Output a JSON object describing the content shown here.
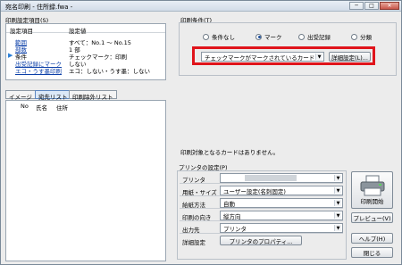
{
  "window": {
    "title": "宛名印刷 - 住所録.fwa -",
    "minimize": "─",
    "maximize": "□",
    "close": "✕"
  },
  "settings": {
    "group_label": "印刷設定項目(S)",
    "header_item": "設定項目",
    "header_value": "設定値",
    "rows": [
      {
        "key": "範囲",
        "value": "すべて：No.1 ～ No.15",
        "link": true
      },
      {
        "key": "部数",
        "value": "1 部",
        "link": true
      },
      {
        "key": "条件",
        "value": "チェックマーク：印刷",
        "link": false,
        "selected": true
      },
      {
        "key": "出受記録にマーク",
        "value": "しない",
        "link": true
      },
      {
        "key": "エコ・うす墨印刷",
        "value": "エコ：しない・うす墨：しない",
        "link": true
      }
    ]
  },
  "tabs": [
    {
      "label": "イメージ",
      "active": false
    },
    {
      "label": "宛先リスト",
      "active": true
    },
    {
      "label": "印刷除外リスト",
      "active": false
    }
  ],
  "list": {
    "col_no": "No",
    "col_name": "氏名",
    "col_address": "住所"
  },
  "conditions": {
    "group_label": "印刷条件(T)",
    "radios": [
      {
        "label": "条件なし",
        "checked": false
      },
      {
        "label": "マーク",
        "checked": true
      },
      {
        "label": "出受記録",
        "checked": false
      },
      {
        "label": "分類",
        "checked": false
      }
    ],
    "select_value": "チェックマークがマークされているカード",
    "detail_button": "詳細設定(L)...",
    "highlight_color": "#e0141b"
  },
  "message": "印刷対象となるカードはありません。",
  "printer": {
    "group_label": "プリンタの設定(P)",
    "rows": [
      {
        "key": "プリンタ",
        "value": ""
      },
      {
        "key": "用紙・サイズ",
        "value": "ユーザー設定(名刺固定)"
      },
      {
        "key": "給紙方法",
        "value": "自動"
      },
      {
        "key": "印刷の向き",
        "value": "縦方向"
      },
      {
        "key": "出力先",
        "value": "プリンタ"
      }
    ],
    "detail_label": "詳細設定",
    "properties_button": "プリンタのプロパティ..."
  },
  "actions": {
    "print": "印刷開始",
    "preview": "プレビュー(V)",
    "help": "ヘルプ(H)",
    "close": "閉じる"
  }
}
